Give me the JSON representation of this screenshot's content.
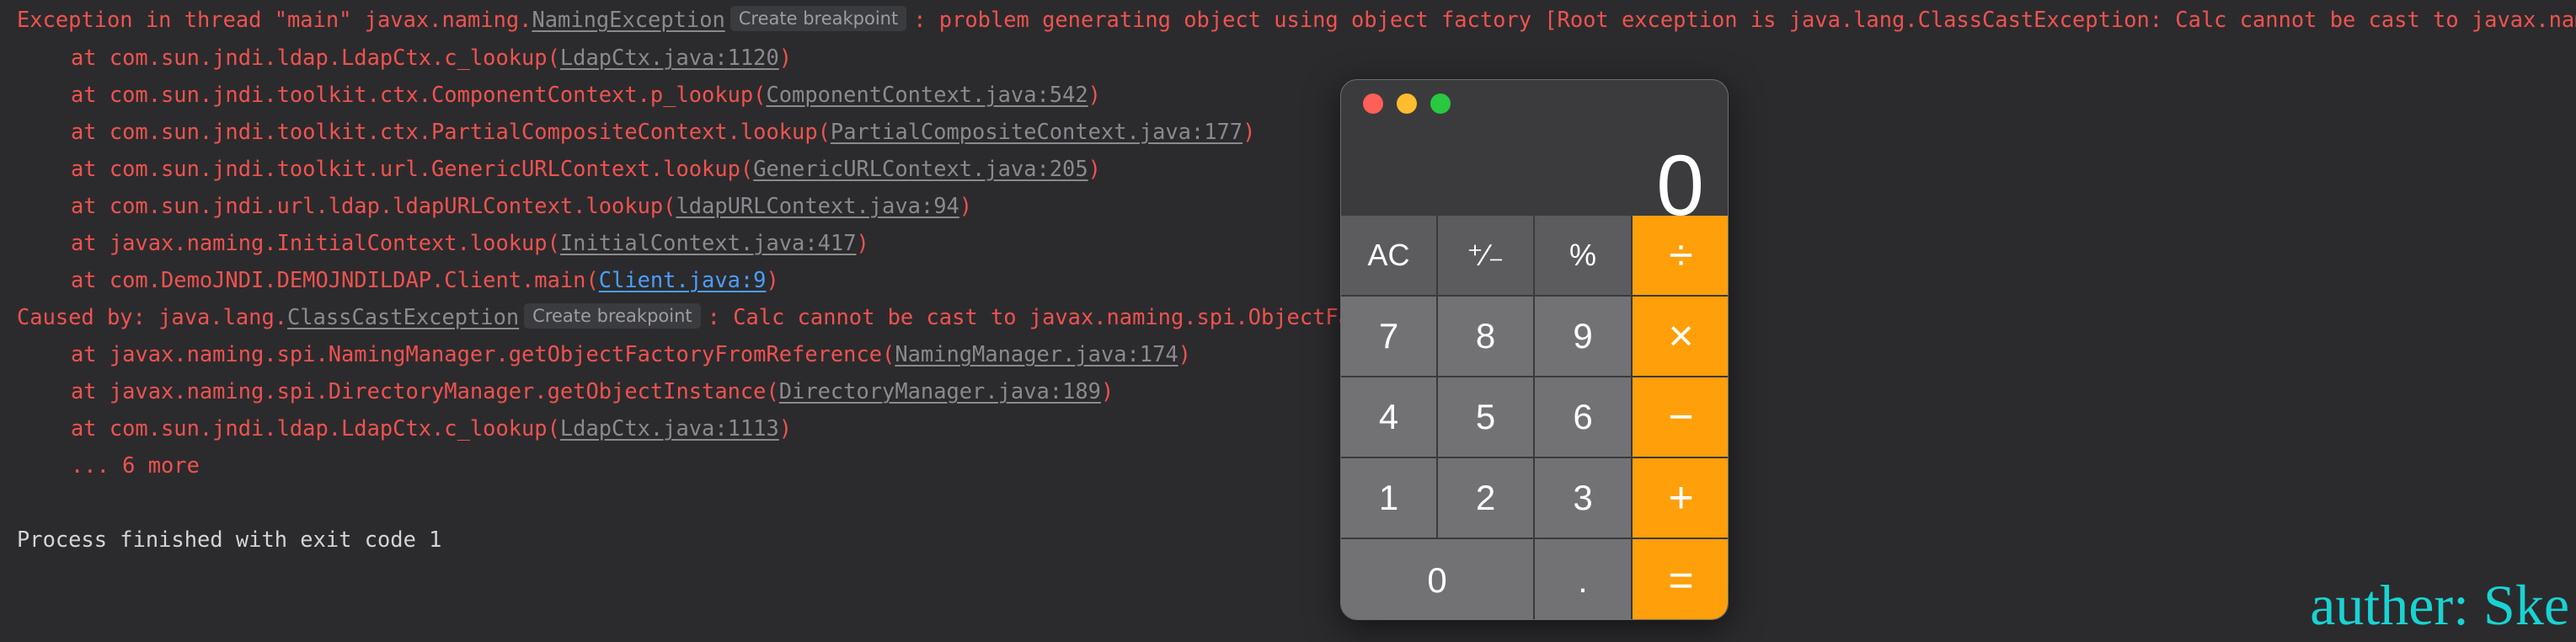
{
  "console": {
    "exception_head": "Exception in thread \"main\" javax.naming.",
    "exception_class": "NamingException",
    "create_breakpoint": "Create breakpoint",
    "exception_tail": ": problem generating object using object factory [Root exception is java.lang.ClassCastException: Calc cannot be cast to javax.naming.spi.ObjectFactory]",
    "trace1": [
      {
        "prefix": "at com.sun.jndi.ldap.LdapCtx.c_lookup(",
        "link": "LdapCtx.java:1120",
        "suffix": ")"
      },
      {
        "prefix": "at com.sun.jndi.toolkit.ctx.ComponentContext.p_lookup(",
        "link": "ComponentContext.java:542",
        "suffix": ")"
      },
      {
        "prefix": "at com.sun.jndi.toolkit.ctx.PartialCompositeContext.lookup(",
        "link": "PartialCompositeContext.java:177",
        "suffix": ")"
      },
      {
        "prefix": "at com.sun.jndi.toolkit.url.GenericURLContext.lookup(",
        "link": "GenericURLContext.java:205",
        "suffix": ")"
      },
      {
        "prefix": "at com.sun.jndi.url.ldap.ldapURLContext.lookup(",
        "link": "ldapURLContext.java:94",
        "suffix": ")"
      },
      {
        "prefix": "at javax.naming.InitialContext.lookup(",
        "link": "InitialContext.java:417",
        "suffix": ")"
      },
      {
        "prefix": "at com.DemoJNDI.DEMOJNDILDAP.Client.main(",
        "link": "Client.java:9",
        "suffix": ")"
      }
    ],
    "caused_head": "Caused by: java.lang.",
    "caused_class": "ClassCastException",
    "caused_tail": ": Calc cannot be cast to javax.naming.spi.ObjectFactory",
    "trace2": [
      {
        "prefix": "at javax.naming.spi.NamingManager.getObjectFactoryFromReference(",
        "link": "NamingManager.java:174",
        "suffix": ")"
      },
      {
        "prefix": "at javax.naming.spi.DirectoryManager.getObjectInstance(",
        "link": "DirectoryManager.java:189",
        "suffix": ")"
      },
      {
        "prefix": "at com.sun.jndi.ldap.LdapCtx.c_lookup(",
        "link": "LdapCtx.java:1113",
        "suffix": ")"
      }
    ],
    "more": "... 6 more",
    "finished": "Process finished with exit code 1"
  },
  "calculator": {
    "display": "0",
    "keys": {
      "ac": "AC",
      "plus_minus": "⁺∕₋",
      "percent": "%",
      "divide": "÷",
      "seven": "7",
      "eight": "8",
      "nine": "9",
      "multiply": "×",
      "four": "4",
      "five": "5",
      "six": "6",
      "minus": "−",
      "one": "1",
      "two": "2",
      "three": "3",
      "plus": "+",
      "zero": "0",
      "decimal": ".",
      "equals": "="
    }
  },
  "watermark": "auther: Ske",
  "colors": {
    "background": "#2b2b2d",
    "error_text": "#f0524f",
    "plain_text": "#d4d4d6",
    "link_gray": "#8a8a8e",
    "link_blue": "#4c9dff",
    "operator_orange": "#ff9f0a",
    "watermark_cyan": "#19d3d3"
  }
}
